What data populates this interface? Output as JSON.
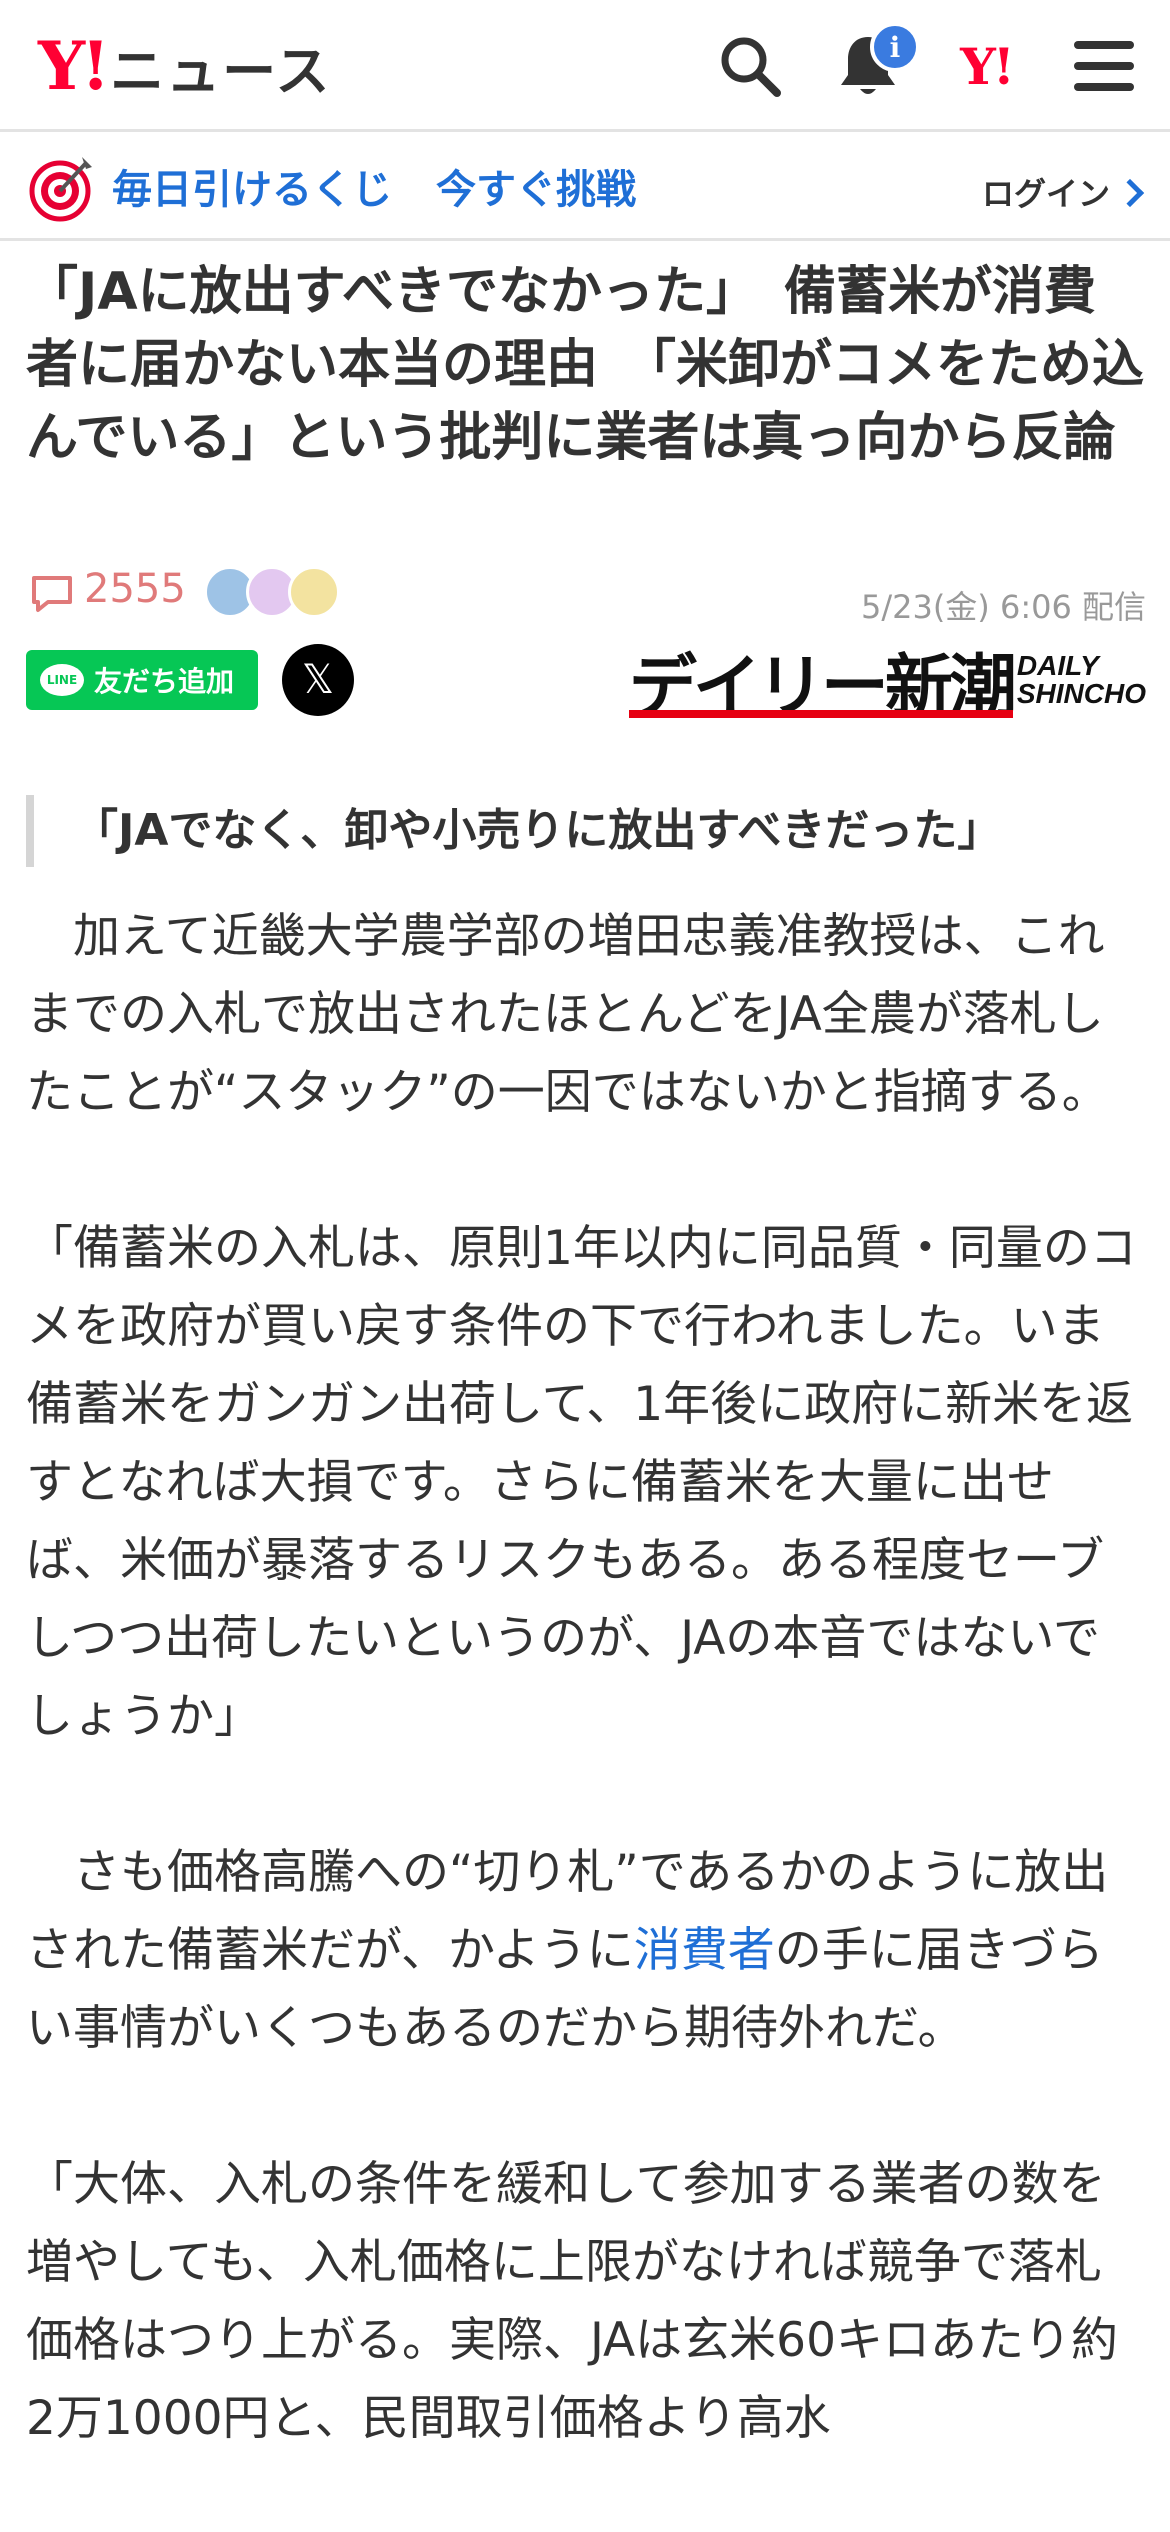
{
  "header": {
    "logo_mark": "Y!",
    "logo_text": "ニュース",
    "notification_badge": "i",
    "yahoo_japan_mark": "Y!"
  },
  "promo": {
    "lottery_text": "毎日引けるくじ",
    "challenge_text": "今すぐ挑戦",
    "login_label": "ログイン"
  },
  "article": {
    "headline": "「JAに放出すべきでなかった」　備蓄米が消費者に届かない本当の理由　「米卸がコメをため込んでいる」という批判に業者は真っ向から反論",
    "comment_count": "2555",
    "date": "5/23(金) 6:06 配信",
    "publisher_jp_1": "デイリー",
    "publisher_jp_2": "新潮",
    "publisher_en_1": "DAILY",
    "publisher_en_2": "SHINCHO",
    "section_heading": "「JAでなく、卸や小売りに放出すべきだった」",
    "paragraphs": {
      "p1": "　加えて近畿大学農学部の増田忠義准教授は、これまでの入札で放出されたほとんどをJA全農が落札したことが“スタック”の一因ではないかと指摘する。",
      "p2": "「備蓄米の入札は、原則1年以内に同品質・同量のコメを政府が買い戻す条件の下で行われました。いま備蓄米をガンガン出荷して、1年後に政府に新米を返すとなれば大損です。さらに備蓄米を大量に出せば、米価が暴落するリスクもある。ある程度セーブしつつ出荷したいというのが、JAの本音ではないでしょうか」",
      "p3_before": "　さも価格高騰への“切り札”であるかのように放出された備蓄米だが、かように",
      "p3_link": "消費者",
      "p3_after": "の手に届きづらい事情がいくつもあるのだから期待外れだ。",
      "p4": "「大体、入札の条件を緩和して参加する業者の数を増やしても、入札価格に上限がなければ競争で落札価格はつり上がる。実際、JAは玄米60キロあたり約2万1000円と、民間取引価格より高水"
    }
  },
  "share": {
    "line_logo": "LINE",
    "line_label": "友だち追加",
    "x_glyph": "𝕏"
  },
  "colors": {
    "brand_red": "#ff0033",
    "link_blue": "#1f6fd6",
    "line_green": "#06c755",
    "comment_pink": "#e07a7a",
    "badge_blue": "#3a7be0"
  }
}
